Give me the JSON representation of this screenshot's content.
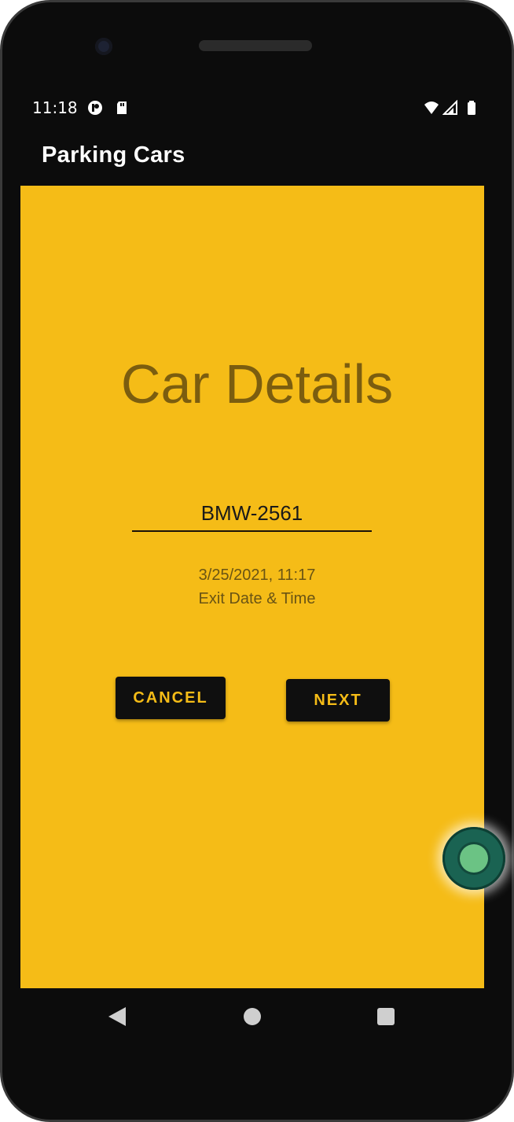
{
  "status_bar": {
    "time": "11:18"
  },
  "app_bar": {
    "title": "Parking Cars"
  },
  "content": {
    "heading": "Car Details",
    "plate_input": {
      "value": "BMW-2561"
    },
    "exit_datetime": "3/25/2021, 11:17",
    "exit_label": "Exit Date & Time",
    "cancel_label": "CANCEL",
    "next_label": "NEXT"
  },
  "colors": {
    "screen_background": "#f5bc17",
    "heading_text": "#7b5d0f",
    "button_background": "#0f0f0f",
    "button_text": "#f5bc17",
    "floating_button": "#1a6352"
  },
  "icons": {
    "status": [
      "notification-icon",
      "sd-card-icon",
      "wifi-icon",
      "signal-icon",
      "battery-icon"
    ],
    "navigation": [
      "back-icon",
      "home-icon",
      "recents-icon"
    ]
  }
}
